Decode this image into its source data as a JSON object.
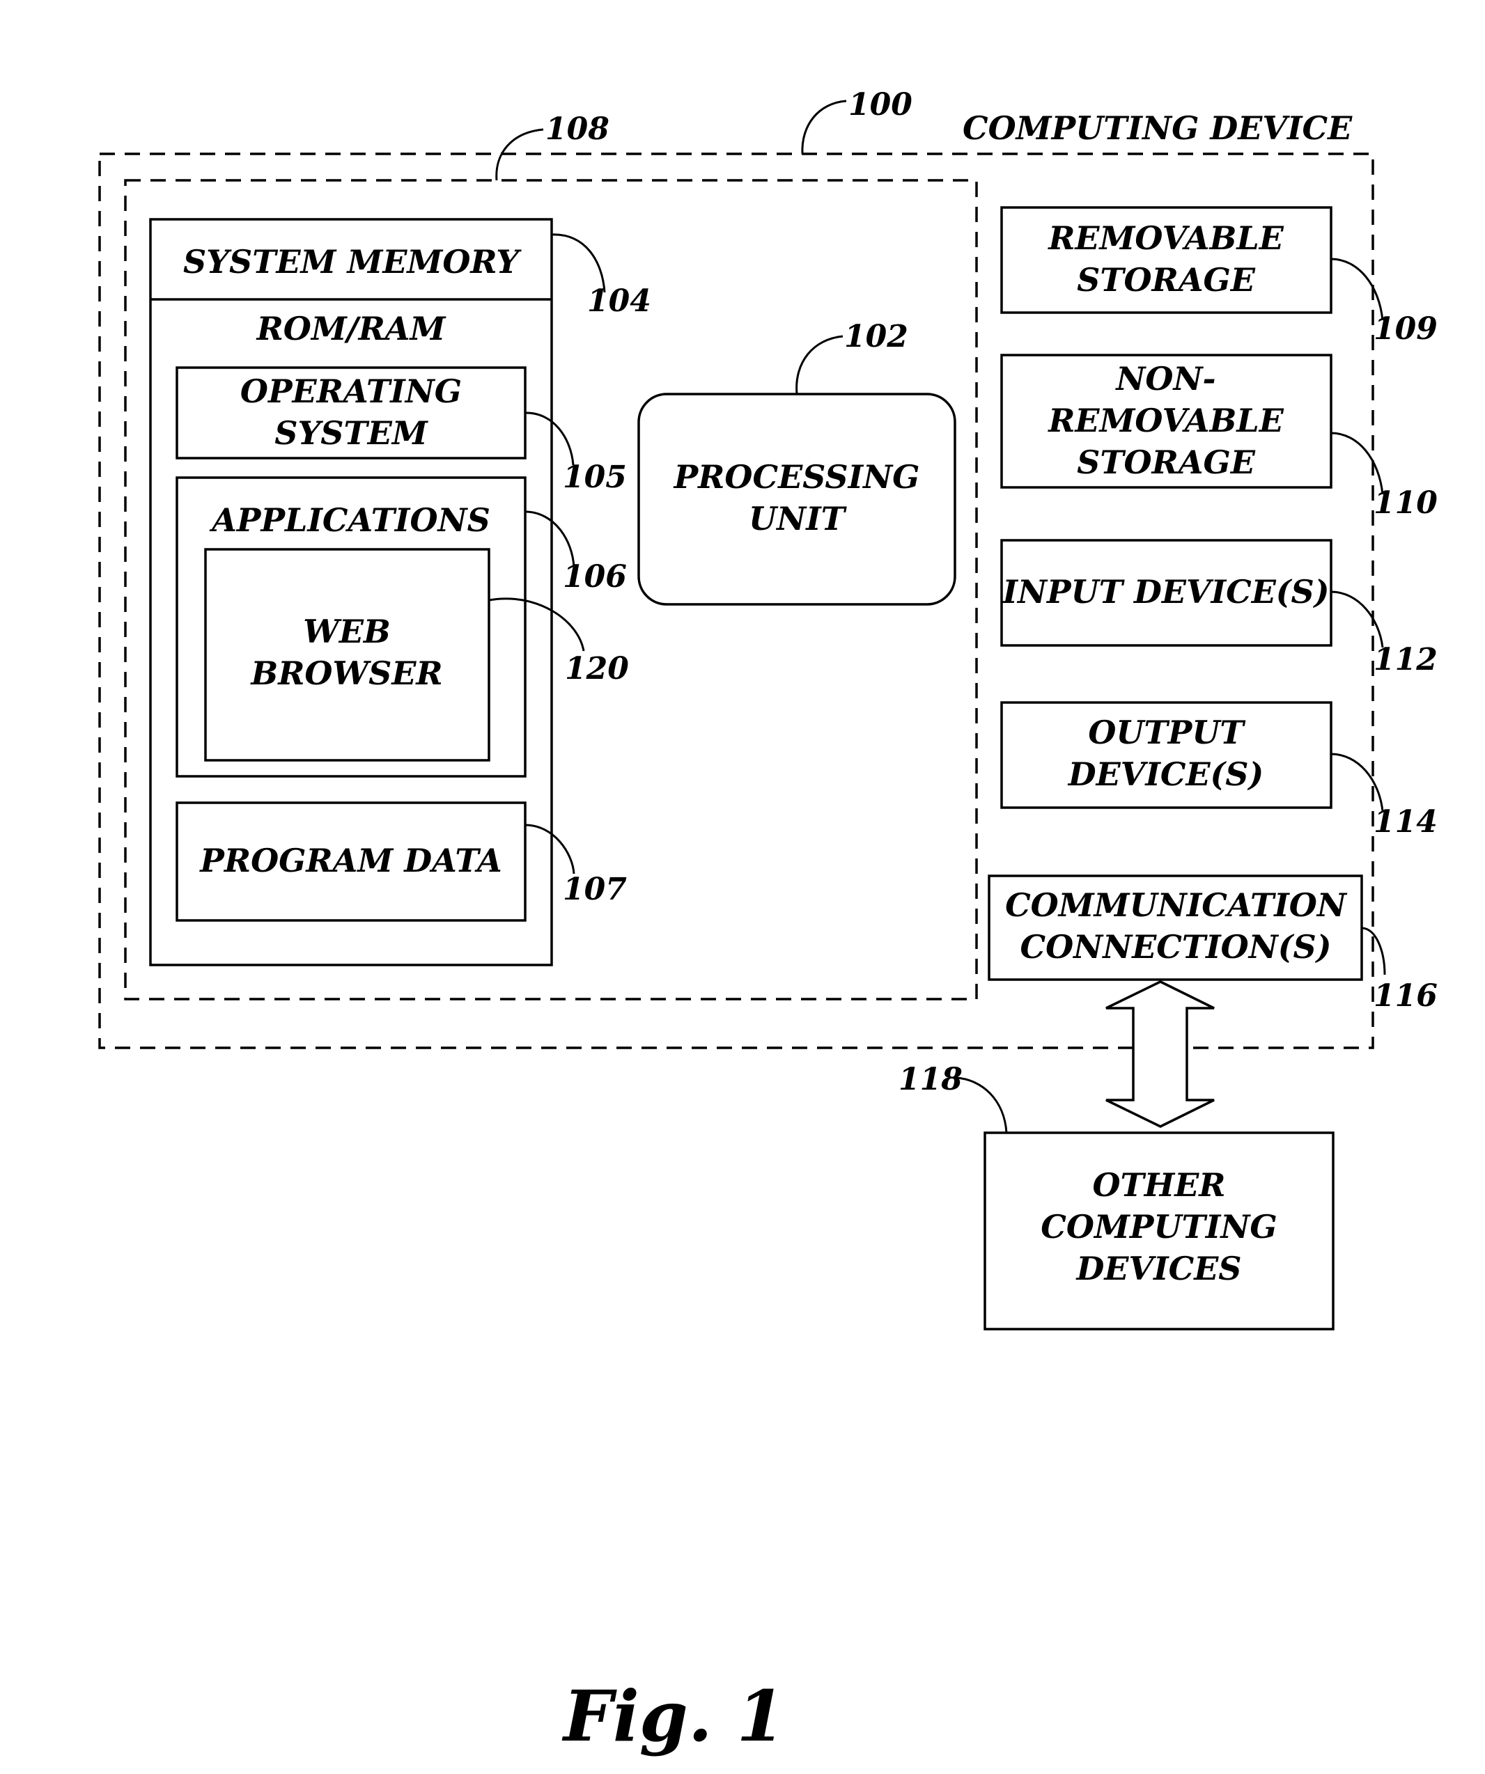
{
  "figure": {
    "caption": "Fig. 1",
    "title": "COMPUTING DEVICE",
    "refs": {
      "computing_device": "100",
      "processing_unit": "102",
      "system_memory": "104",
      "operating_system": "105",
      "applications": "106",
      "program_data": "107",
      "basic_config": "108",
      "removable_storage": "109",
      "non_removable_storage": "110",
      "input_devices": "112",
      "output_devices": "114",
      "communication_connections": "116",
      "other_computing_devices": "118",
      "web_browser": "120"
    },
    "labels": {
      "system_memory": "SYSTEM MEMORY",
      "rom_ram": "ROM/RAM",
      "operating_system": [
        "OPERATING",
        "SYSTEM"
      ],
      "applications": "APPLICATIONS",
      "web_browser": [
        "WEB",
        "BROWSER"
      ],
      "program_data": "PROGRAM DATA",
      "processing_unit": [
        "PROCESSING",
        "UNIT"
      ],
      "removable_storage": [
        "REMOVABLE",
        "STORAGE"
      ],
      "non_removable_storage": [
        "NON-",
        "REMOVABLE",
        "STORAGE"
      ],
      "input_devices": "INPUT DEVICE(S)",
      "output_devices": [
        "OUTPUT",
        "DEVICE(S)"
      ],
      "communication_connections": [
        "COMMUNICATION",
        "CONNECTION(S)"
      ],
      "other_computing_devices": [
        "OTHER",
        "COMPUTING",
        "DEVICES"
      ]
    }
  }
}
